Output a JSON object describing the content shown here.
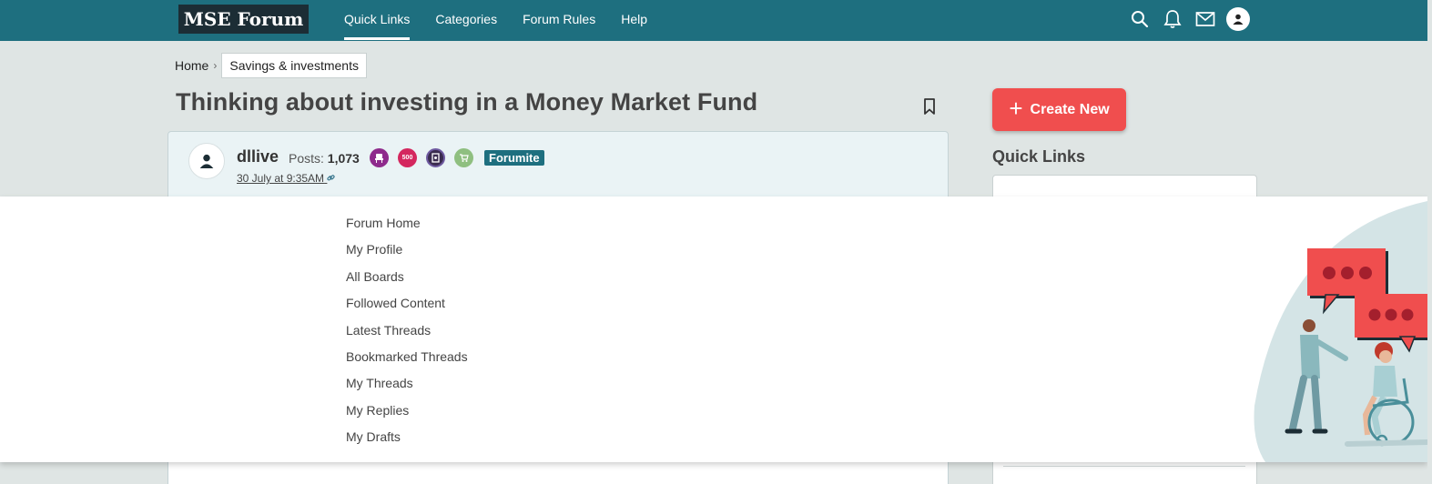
{
  "header": {
    "logo": "MSE Forum",
    "nav": [
      {
        "label": "Quick Links",
        "active": true
      },
      {
        "label": "Categories"
      },
      {
        "label": "Forum Rules"
      },
      {
        "label": "Help"
      }
    ],
    "icons": [
      "search-icon",
      "bell-icon",
      "mail-icon",
      "user-icon"
    ]
  },
  "breadcrumb": {
    "home": "Home",
    "separator": "›",
    "current": "Savings & investments"
  },
  "thread": {
    "title": "Thinking about investing in a Money Market Fund"
  },
  "post": {
    "username": "dllive",
    "posts_label": "Posts:",
    "posts_count": "1,073",
    "badges": [
      {
        "icon": "chair-badge-icon",
        "color": "#8e2a8c",
        "text": ""
      },
      {
        "icon": "500-badge-icon",
        "color": "#d4275e",
        "text": "500"
      },
      {
        "icon": "dark-badge-icon",
        "color": "#3b2c4f",
        "text": ""
      },
      {
        "icon": "cart-badge-icon",
        "color": "#8fbf80",
        "text": ""
      }
    ],
    "rank": "Forumite",
    "date": "30 July at 9:35AM"
  },
  "sidebar": {
    "create_label": "Create New",
    "quick_links_heading": "Quick Links",
    "panel_first_item": "Forum Home",
    "panel_last_item": "My Replies"
  },
  "dropdown": {
    "items": [
      "Forum Home",
      "My Profile",
      "All Boards",
      "Followed Content",
      "Latest Threads",
      "Bookmarked Threads",
      "My Threads",
      "My Replies",
      "My Drafts"
    ]
  },
  "colors": {
    "topbar": "#1e6f7f",
    "accent": "#f04e4e",
    "background": "#dfe5e4"
  }
}
